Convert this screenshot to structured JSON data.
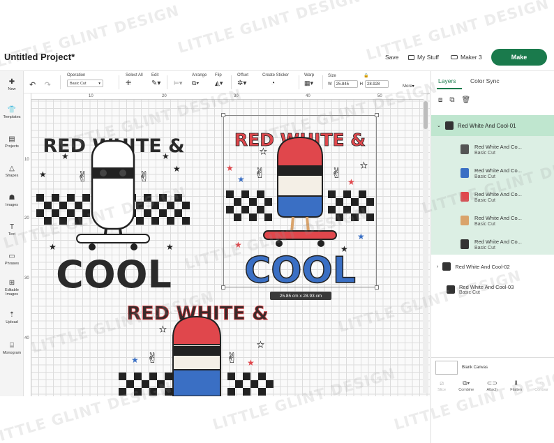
{
  "header": {
    "project_title": "Untitled Project*",
    "save_label": "Save",
    "mystuff_label": "My Stuff",
    "machine_label": "Maker 3",
    "make_label": "Make"
  },
  "toolbar": {
    "operation_label": "Operation",
    "operation_value": "Basic Cut",
    "selectall_label": "Select All",
    "edit_label": "Edit",
    "arrange_label": "Arrange",
    "flip_label": "Flip",
    "offset_label": "Offset",
    "create_sticker_label": "Create Sticker",
    "warp_label": "Warp",
    "size_label": "Size",
    "w_label": "W",
    "w_value": "25.845",
    "h_label": "H",
    "h_value": "28.928",
    "more_label": "More"
  },
  "sidebar": {
    "items": [
      {
        "label": "New",
        "icon": "plus-icon"
      },
      {
        "label": "Templates",
        "icon": "shirt-icon"
      },
      {
        "label": "Projects",
        "icon": "projects-icon"
      },
      {
        "label": "Shapes",
        "icon": "shapes-icon"
      },
      {
        "label": "Images",
        "icon": "image-icon"
      },
      {
        "label": "Text",
        "icon": "text-icon"
      },
      {
        "label": "Phrases",
        "icon": "phrases-icon"
      },
      {
        "label": "Editable Images",
        "icon": "editable-image-icon"
      },
      {
        "label": "Upload",
        "icon": "upload-icon"
      },
      {
        "label": "Monogram",
        "icon": "monogram-icon"
      }
    ]
  },
  "rulers": {
    "top": [
      "10",
      "20",
      "30",
      "40",
      "50"
    ],
    "left": [
      "10",
      "20",
      "30",
      "40"
    ]
  },
  "artwork": {
    "headline": "RED WHITE &",
    "word": "COOL",
    "dimensions": "25.85 cm x 28.93 cm",
    "colors": {
      "red": "#e0474c",
      "blue": "#3a6fc4",
      "black": "#222222",
      "cream": "#f4efe6"
    }
  },
  "panel": {
    "tab_layers": "Layers",
    "tab_colorsync": "Color Sync",
    "group1": "Red White And Cool-01",
    "sublayers": [
      {
        "name": "Red White And Co...",
        "sub": "Basic Cut"
      },
      {
        "name": "Red White And Co...",
        "sub": "Basic Cut"
      },
      {
        "name": "Red White And Co...",
        "sub": "Basic Cut"
      },
      {
        "name": "Red White And Co...",
        "sub": "Basic Cut"
      },
      {
        "name": "Red White And Co...",
        "sub": "Basic Cut"
      }
    ],
    "group2": "Red White And Cool-02",
    "group3": "Red White And Cool-03",
    "group3_sub": "Basic Cut",
    "blank_canvas": "Blank Canvas",
    "actions": [
      "Slice",
      "Combine",
      "Attach",
      "Flatten",
      "Contour"
    ]
  },
  "watermark": "LITTLE GLINT DESIGN",
  "accent_color": "#1a7a4c"
}
